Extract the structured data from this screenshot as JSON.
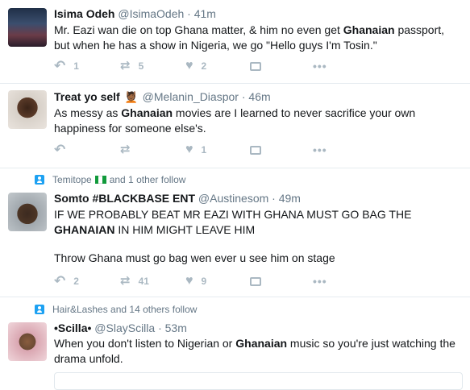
{
  "tweets": [
    {
      "name": "Isima Odeh",
      "handle": "@IsimaOdeh",
      "time": "41m",
      "body": [
        {
          "t": "Mr. Eazi wan die on top Ghana matter, & him no even get "
        },
        {
          "t": "Ghanaian",
          "b": true
        },
        {
          "t": " passport, but when he has a show in Nigeria, we go \"Hello guys I'm Tosin.\""
        }
      ],
      "replies": "1",
      "retweets": "5",
      "likes": "2"
    },
    {
      "name": "Treat yo self",
      "name_emoji": "💆🏾",
      "handle": "@Melanin_Diaspor",
      "time": "46m",
      "body": [
        {
          "t": "As messy as "
        },
        {
          "t": "Ghanaian",
          "b": true
        },
        {
          "t": " movies are I learned to never sacrifice your own happiness for someone else's."
        }
      ],
      "replies": "",
      "retweets": "",
      "likes": "1"
    },
    {
      "context_name": "Temitope",
      "context_rest": "and 1 other follow",
      "name": "Somto #BLACKBASE ENT",
      "handle": "@Austinesom",
      "time": "49m",
      "body": [
        {
          "t": "IF WE PROBABLY BEAT MR EAZI WITH GHANA MUST GO BAG THE "
        },
        {
          "t": "GHANAIAN",
          "b": true
        },
        {
          "t": " IN HIM MIGHT LEAVE HIM"
        }
      ],
      "body2": "Throw Ghana must go bag wen ever u see him on stage",
      "replies": "2",
      "retweets": "41",
      "likes": "9"
    },
    {
      "context_text": "Hair&Lashes and 14 others follow",
      "name": "•Scilla•",
      "handle": "@SlayScilla",
      "time": "53m",
      "body": [
        {
          "t": "When you don't listen to Nigerian or "
        },
        {
          "t": "Ghanaian",
          "b": true
        },
        {
          "t": " music so you're just watching the drama unfold."
        }
      ]
    }
  ],
  "icons": {
    "reply": "reply-icon",
    "retweet": "retweet-icon",
    "like": "heart-icon",
    "dm": "direct-message-icon",
    "more": "more-icon"
  },
  "colors": {
    "accent": "#1da1f2",
    "muted": "#657786",
    "action": "#aab8c2",
    "border": "#e6ecf0"
  }
}
